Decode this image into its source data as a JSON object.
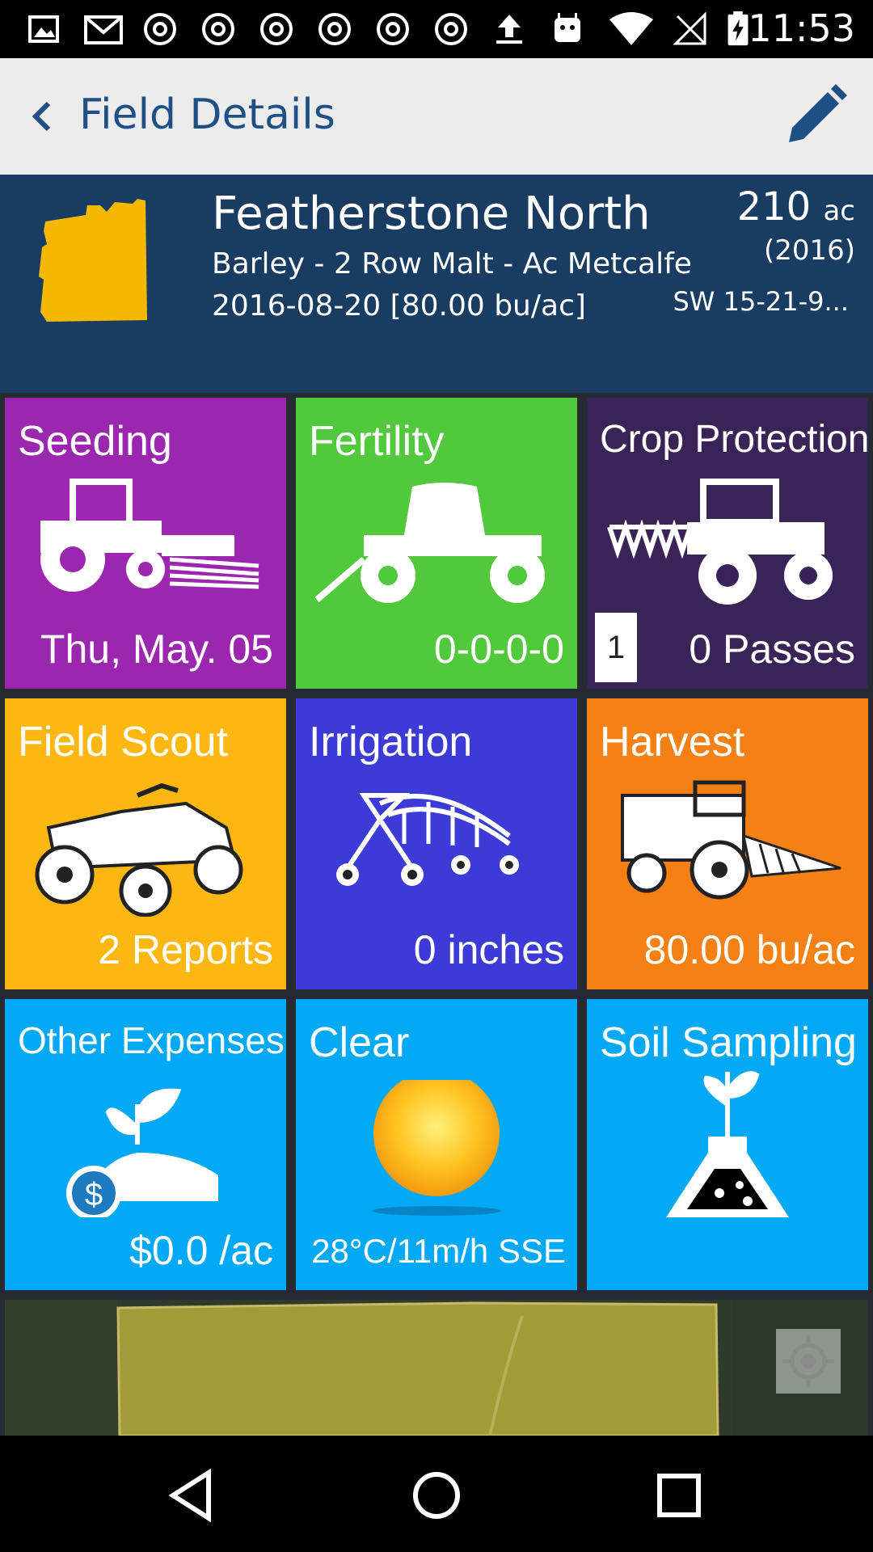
{
  "status_bar": {
    "time": "11:53"
  },
  "app_bar": {
    "title": "Field Details"
  },
  "field": {
    "name": "Featherstone North",
    "crop": "Barley - 2 Row Malt - Ac Metcalfe",
    "harvest": "2016-08-20 [80.00 bu/ac]",
    "acres": "210",
    "acres_unit": "ac",
    "year": "(2016)",
    "legal": "SW 15-21-9...",
    "shape_color": "#f4b800"
  },
  "tiles": [
    {
      "title": "Seeding",
      "value": "Thu, May. 05",
      "color": "#9b27af",
      "icon": "seeder-tractor-icon"
    },
    {
      "title": "Fertility",
      "value": "0-0-0-0",
      "color": "#52c93c",
      "icon": "fertilizer-cart-icon"
    },
    {
      "title": "Crop Protection",
      "value": "0 Passes",
      "count": "1",
      "color": "#3a2356",
      "icon": "sprayer-icon"
    },
    {
      "title": "Field Scout",
      "value": "2 Reports",
      "color": "#fcb711",
      "icon": "atv-icon"
    },
    {
      "title": "Irrigation",
      "value": "0 inches",
      "color": "#3c3bd8",
      "icon": "pivot-irrigation-icon"
    },
    {
      "title": "Harvest",
      "value": "80.00 bu/ac",
      "color": "#f58015",
      "icon": "combine-icon"
    },
    {
      "title": "Other Expenses",
      "value": "$0.0 /ac",
      "color": "#03a9f4",
      "icon": "money-plant-icon"
    },
    {
      "title": "Clear",
      "value": "28°C/11m/h SSE",
      "color": "#03a9f4",
      "icon": "sun-icon"
    },
    {
      "title": "Soil Sampling",
      "value": "",
      "color": "#03a9f4",
      "icon": "flask-sprout-icon"
    }
  ]
}
